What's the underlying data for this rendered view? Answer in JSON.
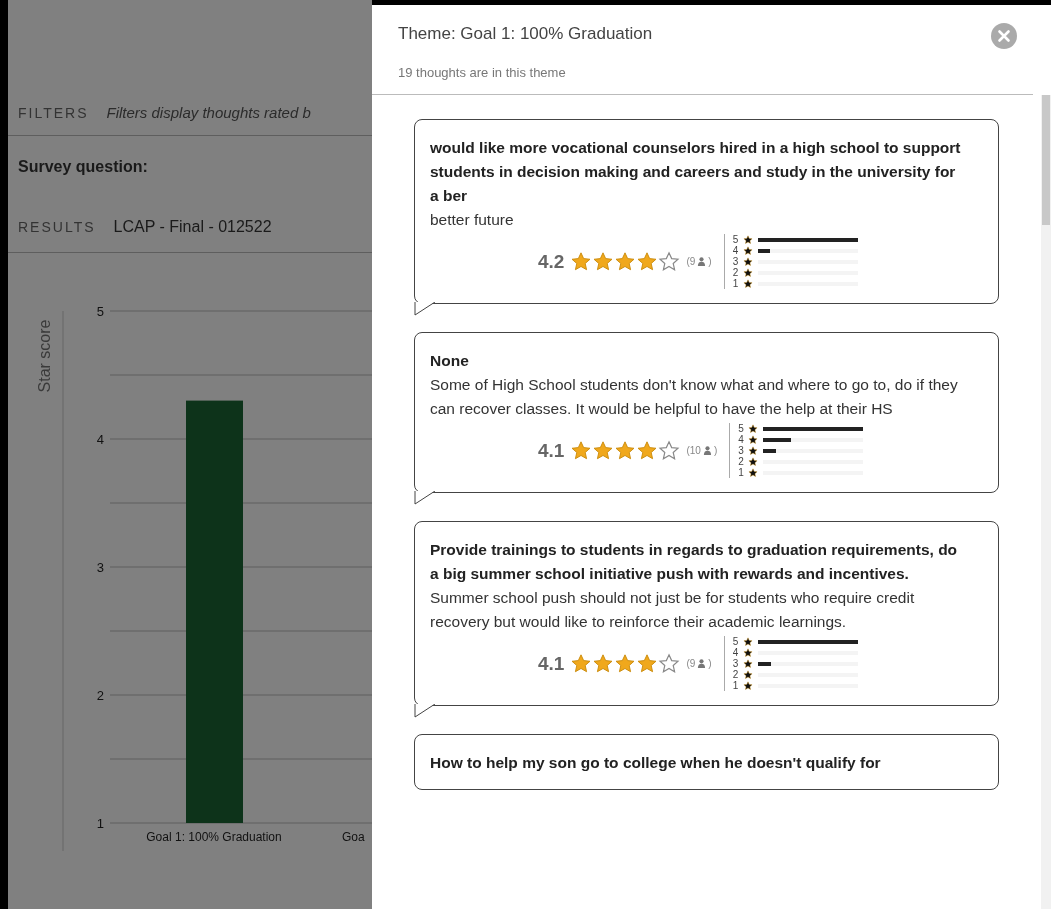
{
  "background": {
    "filters": {
      "label": "FILTERS",
      "hint": "Filters display thoughts rated b"
    },
    "survey_question": {
      "label": "Survey question:"
    },
    "results": {
      "label": "RESULTS",
      "name": "LCAP - Final - 012522"
    },
    "chart": {
      "chart_data": {
        "type": "bar",
        "ylabel": "Star score",
        "categories": [
          "Goal 1: 100% Graduation",
          "Goa"
        ],
        "series": [
          {
            "color": "#0d331a",
            "values": [
              4.3,
              null
            ]
          }
        ],
        "grid": true,
        "ylim": [
          1,
          5
        ],
        "yticks": [
          1,
          2,
          3,
          4,
          5
        ]
      }
    }
  },
  "panel": {
    "title": "Theme: Goal 1: 100% Graduation",
    "subtitle": "19 thoughts are in this theme",
    "thoughts": [
      {
        "title": "would like more vocational counselors hired in a high school to support students in decision making and careers and study in the university for a ber",
        "body": "better future",
        "rating": {
          "score": "4.2",
          "stars": 4,
          "count": "(9",
          "count_end": ")",
          "distribution": [
            {
              "label": "5",
              "level": 1.0
            },
            {
              "label": "4",
              "level": 0.12
            },
            {
              "label": "3"
            },
            {
              "label": "2"
            },
            {
              "label": "1"
            }
          ]
        }
      },
      {
        "title": "None",
        "body": "Some of High School students don't know what and where to go to, do if they can recover classes. It would be helpful to have the help at their HS",
        "rating": {
          "score": "4.1",
          "stars": 4,
          "count": "(10",
          "count_end": ")",
          "distribution": [
            {
              "label": "5",
              "level": 1.0
            },
            {
              "label": "4",
              "level": 0.28
            },
            {
              "label": "3",
              "level": 0.13
            },
            {
              "label": "2"
            },
            {
              "label": "1"
            }
          ]
        }
      },
      {
        "title": "Provide trainings to students in regards to graduation requirements, do a big summer school initiative push with rewards and incentives.",
        "body": "Summer school push should not just be for students who require credit recovery but would like to reinforce their academic learnings.",
        "rating": {
          "score": "4.1",
          "stars": 4,
          "count": "(9",
          "count_end": ")",
          "distribution": [
            {
              "label": "5",
              "level": 1.0
            },
            {
              "label": "4"
            },
            {
              "label": "3",
              "level": 0.13
            },
            {
              "label": "2"
            },
            {
              "label": "1"
            }
          ]
        }
      },
      {
        "title": "How to help my son go to college when he doesn't qualify for"
      }
    ]
  }
}
